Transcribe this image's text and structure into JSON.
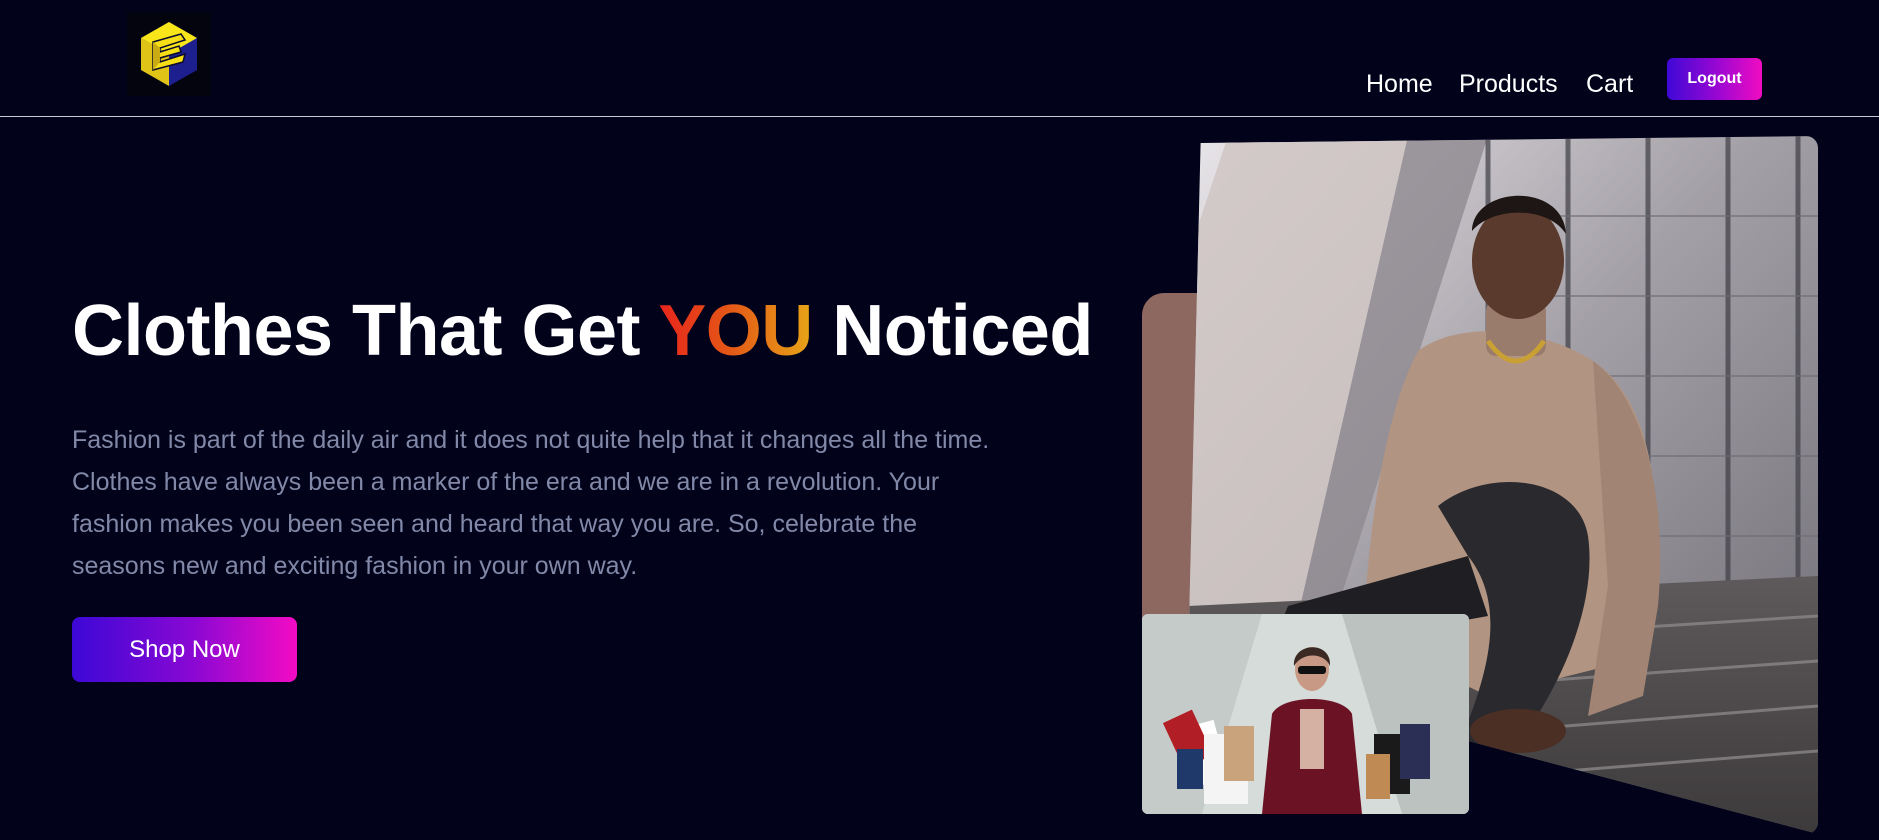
{
  "nav": {
    "links": [
      {
        "label": "Home"
      },
      {
        "label": "Products"
      },
      {
        "label": "Cart"
      }
    ],
    "logout_label": "Logout"
  },
  "hero": {
    "title_before": "Clothes That Get ",
    "title_accent": "YOU",
    "title_after": " Noticed",
    "description": "Fashion is part of the daily air and it does not quite help that it changes all the time. Clothes have always been a marker of the era and we are in a revolution. Your fashion makes you been seen and heard that way you are. So, celebrate the seasons new and exciting fashion in your own way.",
    "cta_label": "Shop Now"
  },
  "colors": {
    "background": "#02031a",
    "button_gradient_start": "#3c08d6",
    "button_gradient_end": "#f40bc4",
    "accent_gradient": [
      "#e8241c",
      "#e7a617"
    ],
    "accent_block": "#8d6860"
  }
}
